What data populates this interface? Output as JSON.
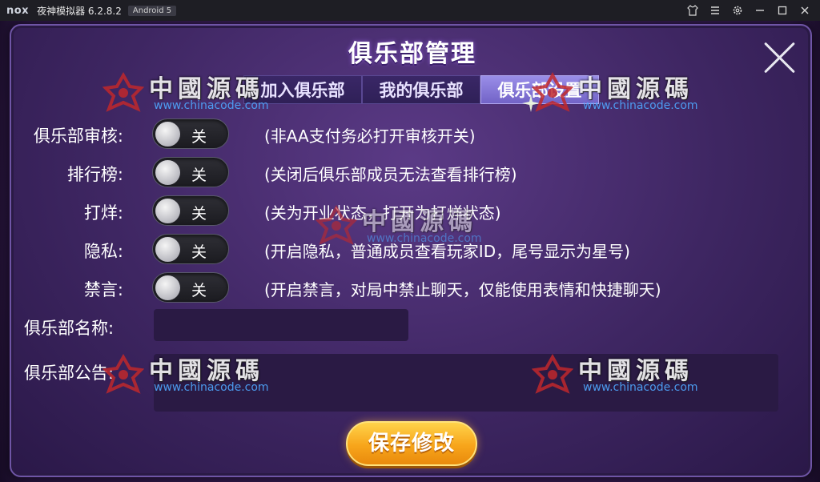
{
  "window": {
    "logo": "nox",
    "title": "夜神模拟器 6.2.8.2",
    "android_badge": "Android 5",
    "controls": [
      "shirt-icon",
      "menu-icon",
      "gear-icon",
      "minimize-icon",
      "maximize-icon",
      "close-icon"
    ]
  },
  "dialog": {
    "title": "俱乐部管理",
    "tabs": [
      {
        "label": "加入俱乐部",
        "active": false
      },
      {
        "label": "我的俱乐部",
        "active": false
      },
      {
        "label": "俱乐部设置",
        "active": true
      }
    ],
    "settings": [
      {
        "label": "俱乐部审核:",
        "toggle": "关",
        "hint": "(非AA支付务必打开审核开关)"
      },
      {
        "label": "排行榜:",
        "toggle": "关",
        "hint": "(关闭后俱乐部成员无法查看排行榜)"
      },
      {
        "label": "打烊:",
        "toggle": "关",
        "hint": "(关为开业状态，打开为打烊状态)"
      },
      {
        "label": "隐私:",
        "toggle": "关",
        "hint": "(开启隐私，普通成员查看玩家ID，尾号显示为星号)"
      },
      {
        "label": "禁言:",
        "toggle": "关",
        "hint": "(开启禁言，对局中禁止聊天，仅能使用表情和快捷聊天)"
      }
    ],
    "name_label": "俱乐部名称:",
    "name_value": "",
    "notice_label": "俱乐部公告:",
    "notice_value": "",
    "save_button": "保存修改"
  },
  "watermark": {
    "title": "中國源碼",
    "url": "www.chinacode.com"
  },
  "colors": {
    "panel": "#3e2662",
    "tab_active": "#7263c7",
    "save_button": "#f7a51b",
    "watermark_symbol": "#c0282b"
  }
}
